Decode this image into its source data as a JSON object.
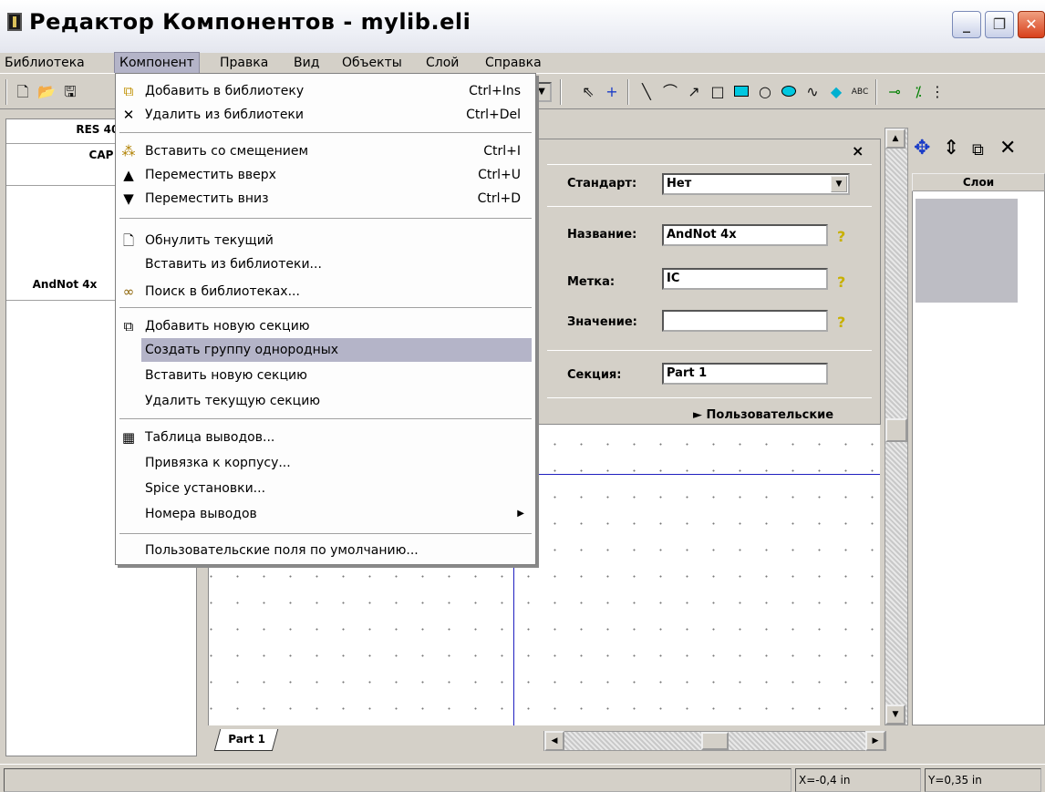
{
  "window": {
    "title": "Редактор Компонентов - mylib.eli"
  },
  "menubar": {
    "items": [
      "Библиотека",
      "Компонент",
      "Правка",
      "Вид",
      "Объекты",
      "Слой",
      "Справка"
    ]
  },
  "component_menu": {
    "items": [
      {
        "label": "Добавить в библиотеку",
        "shortcut": "Ctrl+Ins",
        "icon": "add-to-library-icon"
      },
      {
        "label": "Удалить из библиотеки",
        "shortcut": "Ctrl+Del",
        "icon": "delete-x-icon"
      },
      {
        "label": "Вставить со смещением",
        "shortcut": "Ctrl+I",
        "icon": "insert-offset-icon"
      },
      {
        "label": "Переместить вверх",
        "shortcut": "Ctrl+U",
        "icon": "triangle-up-icon"
      },
      {
        "label": "Переместить вниз",
        "shortcut": "Ctrl+D",
        "icon": "triangle-down-icon"
      },
      {
        "label": "Обнулить текущий",
        "shortcut": "",
        "icon": "blank-page-icon"
      },
      {
        "label": "Вставить из библиотеки...",
        "shortcut": "",
        "icon": ""
      },
      {
        "label": "Поиск в библиотеках...",
        "shortcut": "",
        "icon": "binoculars-icon"
      },
      {
        "label": "Добавить новую секцию",
        "shortcut": "",
        "icon": "add-section-icon"
      },
      {
        "label": "Создать группу однородных",
        "shortcut": "",
        "icon": ""
      },
      {
        "label": "Вставить новую секцию",
        "shortcut": "",
        "icon": ""
      },
      {
        "label": "Удалить текущую секцию",
        "shortcut": "",
        "icon": ""
      },
      {
        "label": "Таблица выводов...",
        "shortcut": "",
        "icon": "pin-table-icon"
      },
      {
        "label": "Привязка к корпусу...",
        "shortcut": "",
        "icon": ""
      },
      {
        "label": "Spice установки...",
        "shortcut": "",
        "icon": ""
      },
      {
        "label": "Номера выводов",
        "shortcut": "",
        "icon": ""
      },
      {
        "label": "Пользовательские поля по умолчанию...",
        "shortcut": "",
        "icon": ""
      }
    ]
  },
  "component_list": [
    "RES 400",
    "CAP",
    "AndNot 4x"
  ],
  "properties": {
    "standard_label": "Стандарт:",
    "standard_value": "Нет",
    "name_label": "Название:",
    "name_value": "AndNot 4x",
    "tag_label": "Метка:",
    "tag_value": "IC",
    "value_label": "Значение:",
    "value_value": "",
    "section_label": "Секция:",
    "section_value": "Part 1",
    "custom_label": "► Пользовательские"
  },
  "layers": {
    "header": "Слои"
  },
  "canvas": {
    "tab_label": "Part 1"
  },
  "status": {
    "x": "X=-0,4 in",
    "y": "Y=0,35 in"
  },
  "toolbar": {
    "text_tool": "ABC"
  }
}
